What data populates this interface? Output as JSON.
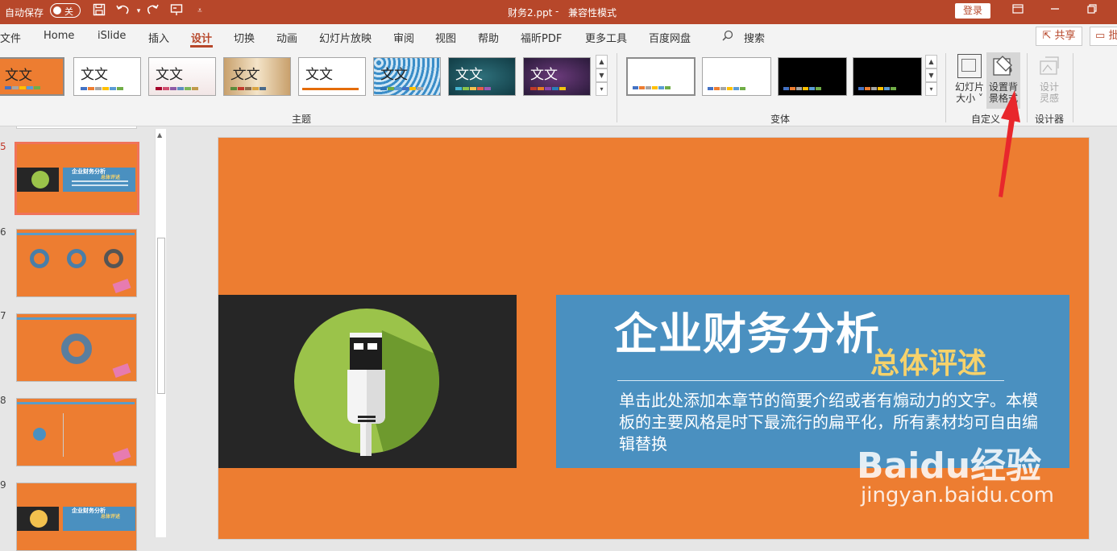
{
  "titlebar": {
    "autosave_label": "自动保存",
    "autosave_state": "关",
    "doc_title": "财务2.ppt",
    "mode": "兼容性模式",
    "login_label": "登录"
  },
  "menu": {
    "items": [
      "文件",
      "Home",
      "iSlide",
      "插入",
      "设计",
      "切换",
      "动画",
      "幻灯片放映",
      "审阅",
      "视图",
      "帮助",
      "福昕PDF",
      "更多工具",
      "百度网盘"
    ],
    "active": "设计",
    "search_label": "搜索",
    "share_label": "共享",
    "comment_label": "批"
  },
  "ribbon": {
    "theme_sample_text": "文文",
    "theme_sample_text_alt": "文文",
    "group_themes": "主题",
    "group_variants": "变体",
    "group_customize": "自定义",
    "group_designer": "设计器",
    "slide_size_label_1": "幻灯片",
    "slide_size_label_2": "大小",
    "format_bg_label_1": "设置背",
    "format_bg_label_2": "景格式",
    "design_ideas_label_1": "设计",
    "design_ideas_label_2": "灵感"
  },
  "thumbnails": [
    {
      "num": "5",
      "title": "企业财务分析",
      "sub": "总体评述"
    },
    {
      "num": "6"
    },
    {
      "num": "7"
    },
    {
      "num": "8"
    },
    {
      "num": "9",
      "title": "企业财务分析",
      "sub": "总体评述"
    }
  ],
  "slide": {
    "title": "企业财务分析",
    "subtitle": "总体评述",
    "body": "单击此处添加本章节的简要介绍或者有煽动力的文字。本模板的主要风格是时下最流行的扁平化，所有素材均可自由编辑替换"
  },
  "watermark": {
    "line1": "Baidu经验",
    "line2": "jingyan.baidu.com"
  },
  "colors": {
    "brand": "#b7472a",
    "slide_bg": "#ed7d31",
    "panel_blue": "#4a90c0",
    "subtitle_yellow": "#f6d26b",
    "arrow_red": "#e8272c"
  }
}
